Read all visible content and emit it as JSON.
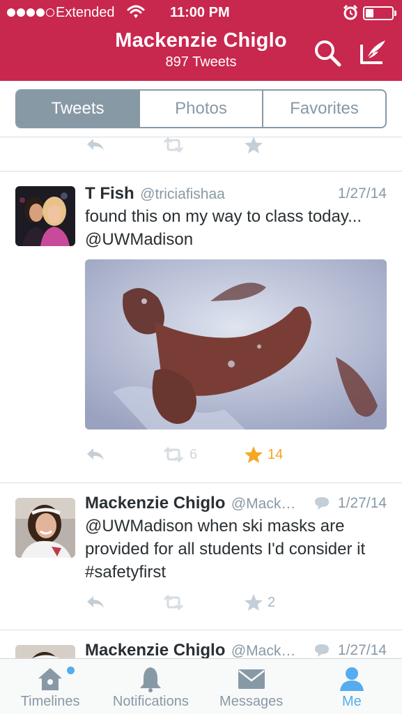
{
  "status_bar": {
    "carrier": "Extended",
    "time": "11:00 PM",
    "signal_bars_filled": 4,
    "signal_bars_total": 5,
    "battery_level": 0.3
  },
  "header": {
    "title": "Mackenzie Chiglo",
    "subtitle": "897 Tweets",
    "background_color": "#c8274e",
    "search_icon": "search-icon",
    "compose_icon": "compose-icon"
  },
  "segment": {
    "tabs": [
      {
        "label": "Tweets",
        "active": true
      },
      {
        "label": "Photos",
        "active": false
      },
      {
        "label": "Favorites",
        "active": false
      }
    ]
  },
  "tweets": [
    {
      "name": "T Fish",
      "handle": "@triciafishaa",
      "date": "1/27/14",
      "text_lines": [
        "found this on my way to class today...",
        "@UWMadison"
      ],
      "has_photo": true,
      "retweets": "6",
      "favorites": "14",
      "favorited": true,
      "has_conversation_icon": false
    },
    {
      "name": "Mackenzie Chiglo",
      "handle": "@Mack…",
      "date": "1/27/14",
      "text_lines": [
        "@UWMadison when ski masks are",
        "provided for all students I'd consider it",
        "#safetyfirst"
      ],
      "has_photo": false,
      "retweets": "",
      "favorites": "2",
      "favorited": false,
      "has_conversation_icon": true
    },
    {
      "name": "Mackenzie Chiglo",
      "handle": "@Mack…",
      "date": "1/27/14",
      "has_conversation_icon": true
    }
  ],
  "tabbar": {
    "items": [
      {
        "label": "Timelines",
        "icon": "home-icon",
        "active": false,
        "has_badge": true
      },
      {
        "label": "Notifications",
        "icon": "bell-icon",
        "active": false,
        "has_badge": false
      },
      {
        "label": "Messages",
        "icon": "envelope-icon",
        "active": false,
        "has_badge": false
      },
      {
        "label": "Me",
        "icon": "person-icon",
        "active": true,
        "has_badge": false
      }
    ]
  },
  "colors": {
    "accent_blue": "#55acee",
    "favorite_gold": "#f5a623",
    "muted_gray": "#8899a6"
  }
}
